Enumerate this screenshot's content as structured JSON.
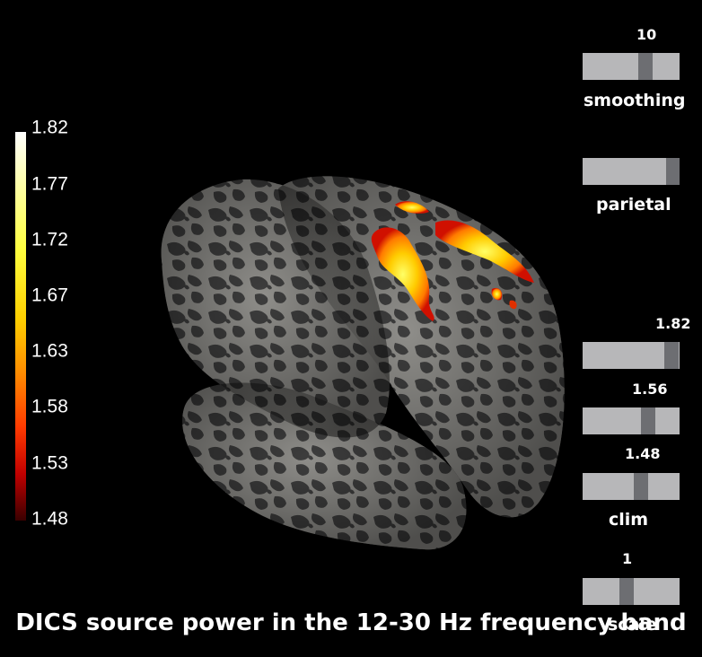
{
  "title": "DICS source power in the 12-30 Hz frequency band",
  "colorbar": {
    "ticks": [
      "1.82",
      "1.77",
      "1.72",
      "1.67",
      "1.63",
      "1.58",
      "1.53",
      "1.48"
    ]
  },
  "sliders": {
    "smoothing": {
      "label": "smoothing",
      "value": "10"
    },
    "view": {
      "label": "parietal"
    },
    "clim_max": {
      "value": "1.82"
    },
    "clim_mid": {
      "value": "1.56"
    },
    "clim_min": {
      "value": "1.48",
      "label": "clim"
    },
    "scale": {
      "value": "1",
      "label": "scale"
    }
  },
  "colors": {
    "background": "#000000",
    "cortex_dark": "#3c3c3c",
    "cortex_light": "#8c8c88",
    "track": "#b7b7b9",
    "knob": "#6d6e72"
  }
}
